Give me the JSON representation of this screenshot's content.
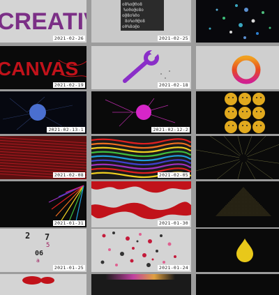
{
  "gallery": {
    "tiles": [
      {
        "date": "2021-02-26",
        "name": "creative-text",
        "text": "CREATIVE"
      },
      {
        "date": "2021-02-25",
        "name": "noise-glyphs"
      },
      {
        "date": "",
        "name": "colored-dots"
      },
      {
        "date": "2021-02-19",
        "name": "canvas-text",
        "text": "CANVAS"
      },
      {
        "date": "2021-02-18",
        "name": "wrench-icon-art"
      },
      {
        "date": "",
        "name": "gradient-ring"
      },
      {
        "date": "2021-02-13-1",
        "name": "blue-circle-particles"
      },
      {
        "date": "2021-02-12-2",
        "name": "magenta-circle-particles"
      },
      {
        "date": "",
        "name": "emoji-faces"
      },
      {
        "date": "2021-02-08",
        "name": "red-moire"
      },
      {
        "date": "2021-02-05",
        "name": "rainbow-waves"
      },
      {
        "date": "",
        "name": "radial-lines"
      },
      {
        "date": "2021-01-31",
        "name": "rainbow-burst"
      },
      {
        "date": "2021-01-30",
        "name": "red-wavy-stripes"
      },
      {
        "date": "",
        "name": "dotted-triangle"
      },
      {
        "date": "2021-01-25",
        "name": "scattered-digits",
        "digits": [
          "2",
          "7",
          "5",
          "06",
          "a"
        ]
      },
      {
        "date": "2021-01-24",
        "name": "colored-bubbles"
      },
      {
        "date": "",
        "name": "yellow-drop"
      },
      {
        "date": "",
        "name": "partial-red"
      },
      {
        "date": "",
        "name": "partial-gradient"
      },
      {
        "date": "",
        "name": "partial-dark"
      }
    ]
  },
  "colors": {
    "background": "#9c9c9c",
    "accent_purple": "#7b2f86",
    "accent_red": "#c1121a",
    "accent_magenta": "#d626c8"
  }
}
